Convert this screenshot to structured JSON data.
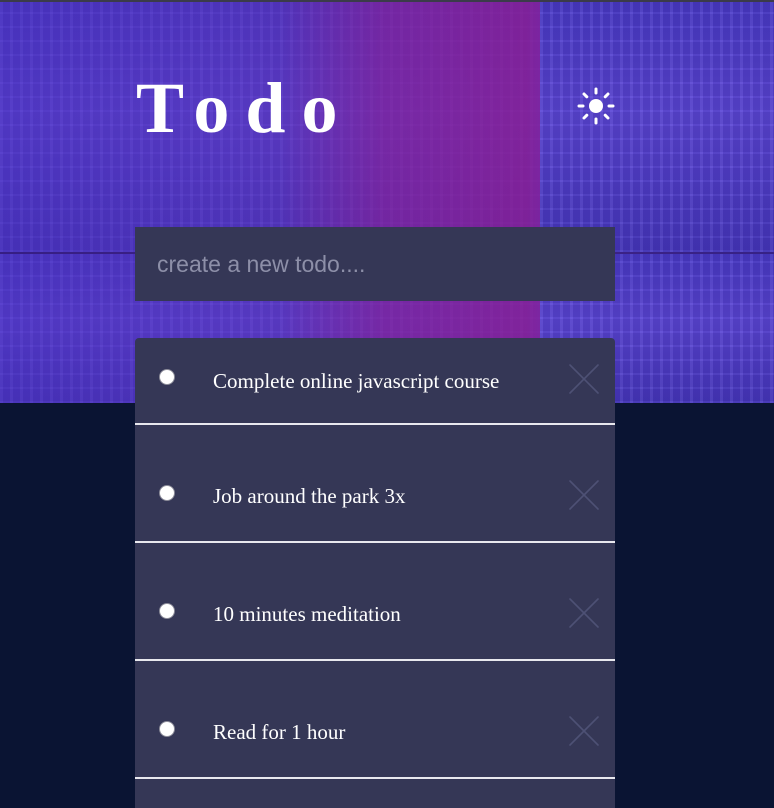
{
  "header": {
    "title": "Todo",
    "theme_toggle_icon": "sun-icon"
  },
  "new_todo": {
    "placeholder": "create a new todo....",
    "value": ""
  },
  "todos": [
    {
      "text": "Complete online javascript course",
      "completed": false
    },
    {
      "text": "Job around the park 3x",
      "completed": false
    },
    {
      "text": "10 minutes meditation",
      "completed": false
    },
    {
      "text": "Read for 1 hour",
      "completed": false
    }
  ],
  "colors": {
    "page_background": "#0a1433",
    "card_background": "#353756",
    "divider": "#e8e8ee",
    "text": "#ffffff",
    "placeholder": "#8d8fa8",
    "delete_icon": "#4e5175"
  }
}
